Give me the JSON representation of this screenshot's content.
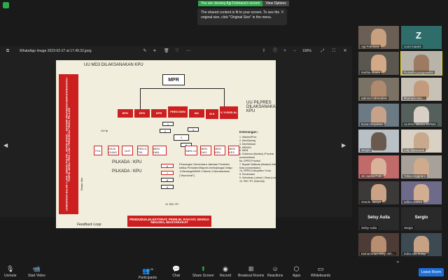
{
  "banner": {
    "viewing": "You are viewing Agi Febriana's screen",
    "options": "View Options"
  },
  "tooltip": {
    "text": "The shared content is fit to your screen. To see the original size, click \"Original Size\" in the menu."
  },
  "viewer": {
    "title": "WhatsApp Image 2023-02-27 at 17.49.32.jpeg",
    "zoom": "100%"
  },
  "slide": {
    "title": "UU MD3 DILAKSANAKAN KPU",
    "mpr": "MPR",
    "institutions": [
      "BPK",
      "DPD",
      "DPR",
      "PRES IDEN",
      "MA",
      "M K",
      "K YUDISI AL"
    ],
    "pilpres": "UU PILPRES DILAKSANAKAN KPU",
    "side_text": "LINGKUNGAN DALAM / LUAR : BIDANG POLITIK, SISTEM SOSIAL - EKONOMI ORGANISASI KEMASYARAKATAN / PARPOL MEDIA/ PERS / LSM / PERGURUAN TINGGI, PELAJAR",
    "ministries": [
      "LPN D",
      "LPN D B",
      "MEN HAN",
      "MEN LU",
      "MEN DAG",
      "MEN KEU",
      "MEN KES",
      "LPN"
    ],
    "uu_tp": "UU tp",
    "row2": [
      "POL",
      "KEJA GUNG",
      "OLR",
      "PEN G TNI",
      "MEN HAN"
    ],
    "numbers": [
      "1",
      "2",
      "3",
      "4",
      "5",
      "6",
      "7",
      "8",
      "9",
      "10. RW / RT"
    ],
    "pilkada1": "PILKADA : KPU",
    "pilkada2": "PILKADA : KPU",
    "diatur": "Diatur dlm",
    "pemangku": "Pemangku Sementara Jabatan Presiden ketika Presiden/Wapres berhalangan tetap: 1.Mendagri/MDN 2.Menlu 3.Menhankam (\"triumvirat\")",
    "keterangan_title": "Keterangan :",
    "keterangan": "1. Wantim/Pres\n2. MenSekneg\n3. MenSekkab\n4. MENKO\n5. MDN\n6. Gubernur (titulatur) /Provinsi (nomenklatur)\n6a. DPRD Provinsi\n7. Bupati/ Walikota (titulatur) Kabupaten / Kota (nomenklatur)\n7a. DPRD Kabupaten / Kota\n8. Kecamatan\n9. Kelurahan (urban) / Desa (rural)\n10. RW / RT (informal)",
    "bottom_box": "PENDUDUK,ELEKTORAT, PEMILIH, RAKYAT, WARGA NEGARA, MASYARAKAT",
    "feedback": "Feedback Loop"
  },
  "participants": [
    {
      "name": "Agi Febriana",
      "bg": "#6b5f55",
      "face": "#c9a07e"
    },
    {
      "name": "zoom baa04",
      "bg": "#2f6d6b",
      "letter": "Z"
    },
    {
      "name": "Muthia khaira",
      "bg": "#5a5650",
      "face": "#d4a988"
    },
    {
      "name": "Rusadi Kantaprawira",
      "bg": "#b8b4aa",
      "face": "#9d7b62",
      "highlight": true
    },
    {
      "name": "admiral rahmadani",
      "bg": "#7a7264",
      "face": "#b08a6e"
    },
    {
      "name": "ilhamadi hilm...",
      "bg": "#c8c2b6",
      "face": "#c39b7c"
    },
    {
      "name": "Nova Oktyahan",
      "bg": "#6c7a84",
      "face": "#c6a28a"
    },
    {
      "name": "ALIFAH NIKKU IRPMA",
      "bg": "#55605c",
      "face": "#d8d0c6"
    },
    {
      "name": "Sergio",
      "bg": "#b9c0c6",
      "face": "#6a5a4e"
    },
    {
      "name": "Luly Qumariah",
      "bg": "#d9d2c4",
      "face": "#c9a98e"
    },
    {
      "name": "Sri Aprilia Putri",
      "bg": "#c06a6a",
      "face": "#d8b39a"
    },
    {
      "name": "Tobia Anggraini",
      "bg": "#a7a19a",
      "face": "#cfaa8d"
    },
    {
      "name": "Oracle Jiwoye",
      "bg": "#3c3a38",
      "face": "#caa285"
    },
    {
      "name": "safira azahra",
      "bg": "#6e6a8a",
      "face": "#d1ad92"
    },
    {
      "name": "Selsy Aulia",
      "bg": "#2a2a2a",
      "text": "Selsy Aulia"
    },
    {
      "name": "Sergio",
      "bg": "#2a2a2a",
      "text": "Sergio"
    },
    {
      "name": "Muhammad Rifky Akh...",
      "bg": "#4d3c36",
      "face": "#b88e70"
    },
    {
      "name": "indra alfa hidayi",
      "bg": "#3d4a52",
      "face": "#c7a183"
    }
  ],
  "bottombar": {
    "unmute": "Unmute",
    "start_video": "Start Video",
    "participants": "Participants",
    "participant_count": "26",
    "chat": "Chat",
    "share": "Share Screen",
    "record": "Record",
    "breakout": "Breakout Rooms",
    "reactions": "Reactions",
    "apps": "Apps",
    "whiteboards": "Whiteboards",
    "leave": "Leave Room"
  },
  "colors": {
    "share_green": "#2ea84a",
    "leave_blue": "#1f6fd6",
    "slide_red": "#cc1f1f"
  }
}
